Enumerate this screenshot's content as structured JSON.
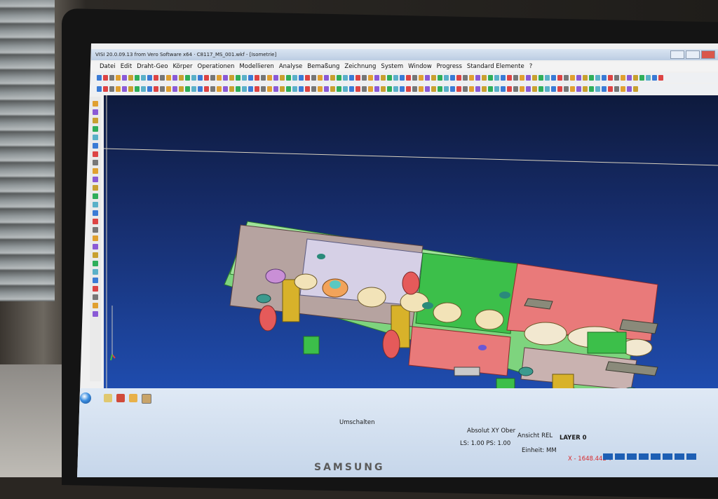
{
  "window": {
    "title": "VISI 20.0.09.13 from Vero Software x64 · C8117_MS_001.wkf - [Isometrie]"
  },
  "menu": {
    "items": [
      "Datei",
      "Edit",
      "Draht-Geo",
      "Körper",
      "Operationen",
      "Modellieren",
      "Analyse",
      "Bemaßung",
      "Zeichnung",
      "System",
      "Window",
      "Progress",
      "Standard Elemente",
      "?"
    ]
  },
  "statusbar": {
    "umschalten": "Umschalten",
    "absolut": "Absolut XY Ober",
    "ansicht": "Ansicht REL",
    "layer": "LAYER 0",
    "ls_ps": "LS: 1.00 PS: 1.00",
    "einheit": "Einheit: MM",
    "coords": "X - 1648.442 Y"
  },
  "monitor": {
    "brand": "SAMSUNG"
  },
  "colors": {
    "accent_blue": "#1e5fb4",
    "viewport_top": "#0e1a3d",
    "viewport_bottom": "#1f4cae",
    "plate_green": "#8de08a",
    "plate_pink": "#e97a7a",
    "component_yellow": "#d8b22a"
  },
  "icons": {
    "start": "windows-start-icon",
    "close": "window-close-icon"
  }
}
